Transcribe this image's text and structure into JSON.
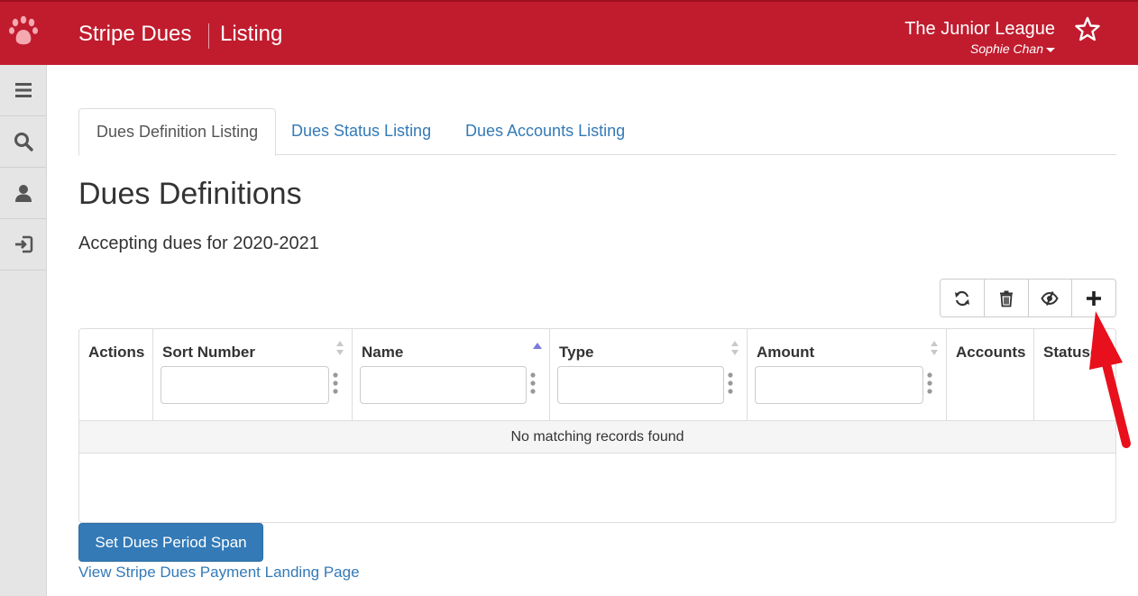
{
  "header": {
    "app_title": "Stripe Dues",
    "section_title": "Listing",
    "org_name": "The Junior League",
    "user_name": "Sophie Chan"
  },
  "sidebar": {
    "items": [
      {
        "icon": "menu-icon"
      },
      {
        "icon": "search-icon"
      },
      {
        "icon": "user-icon"
      },
      {
        "icon": "logout-icon"
      }
    ]
  },
  "tabs": [
    {
      "label": "Dues Definition Listing",
      "active": true
    },
    {
      "label": "Dues Status Listing",
      "active": false
    },
    {
      "label": "Dues Accounts Listing",
      "active": false
    }
  ],
  "main": {
    "title": "Dues Definitions",
    "subtitle": "Accepting dues for 2020-2021"
  },
  "toolbar": {
    "buttons": [
      "refresh-icon",
      "trash-icon",
      "eye-slash-icon",
      "plus-icon"
    ]
  },
  "table": {
    "columns": [
      {
        "label": "Actions"
      },
      {
        "label": "Sort Number"
      },
      {
        "label": "Name"
      },
      {
        "label": "Type"
      },
      {
        "label": "Amount"
      },
      {
        "label": "Accounts"
      },
      {
        "label": "Statuses"
      }
    ],
    "empty_message": "No matching records found"
  },
  "actions": {
    "set_period_label": "Set Dues Period Span",
    "landing_link": "View Stripe Dues Payment Landing Page"
  },
  "colors": {
    "brand": "#c01c2e",
    "primary": "#337ab7"
  }
}
